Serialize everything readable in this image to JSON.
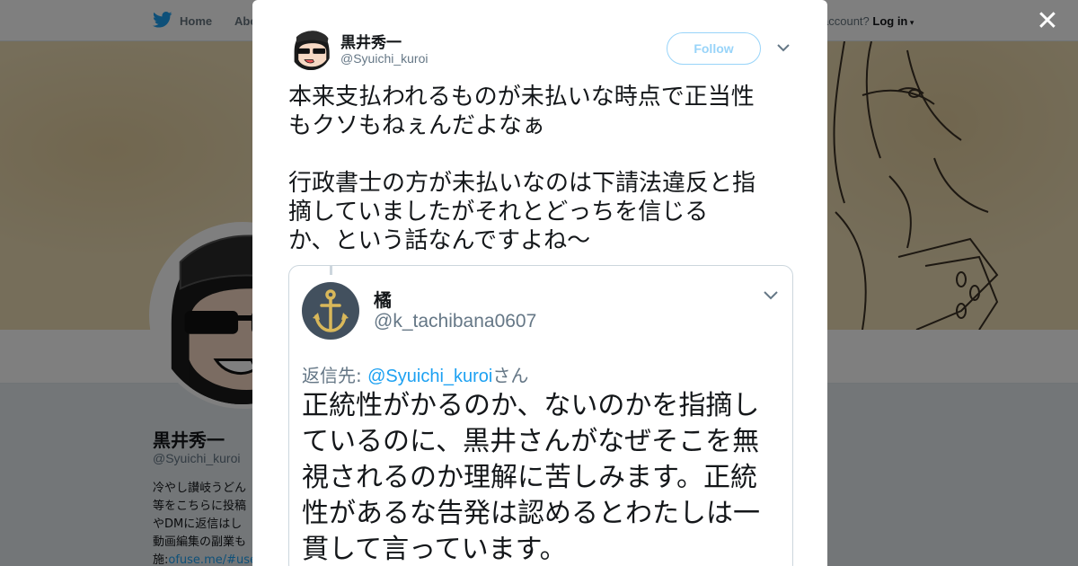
{
  "nav": {
    "home_label": "Home",
    "about_label": "Abo",
    "account_prompt": "account?",
    "login_label": "Log in"
  },
  "profile": {
    "name": "黒井秀一",
    "handle": "@Syuichi_kuroi",
    "bio_lines": [
      "冷やし讃岐うどん",
      "等をこちらに投稿",
      "やDMに返信はし",
      "動画編集の副業も"
    ],
    "bio_link_prefix": "施:",
    "bio_link": "ofuse.me/#use"
  },
  "tweet": {
    "author_name": "黒井秀一",
    "author_handle": "@Syuichi_kuroi",
    "follow_label": "Follow",
    "text_lines_p1": [
      "本来支払われるものが未払いな時点で正当性",
      "もクソもねぇんだよなぁ"
    ],
    "text_lines_p2": [
      "行政書士の方が未払いなのは下請法違反と指",
      "摘していましたがそれとどっちを信じる",
      "か、という話なんですよね〜"
    ]
  },
  "quoted": {
    "author_name": "橘",
    "author_handle": "@k_tachibana0607",
    "reply_prefix": "返信先: ",
    "reply_mention": "@Syuichi_kuroi",
    "reply_suffix": "さん",
    "body_lines": [
      "正統性がかるのか、ないのかを指摘し",
      "ているのに、黒井さんがなぜそこを無",
      "視されるのか理解に苦しみます。正統",
      "性があるな告発は認めるとわたしは一",
      "貫して言っています。"
    ]
  },
  "icons": {
    "brand": "twitter-bird-icon",
    "close": "close-icon",
    "menu": "chevron-down-icon"
  },
  "colors": {
    "brand_blue": "#1da1f2",
    "text": "#14171a",
    "secondary_text": "#657786",
    "header_tint": "#ecdcb4"
  }
}
